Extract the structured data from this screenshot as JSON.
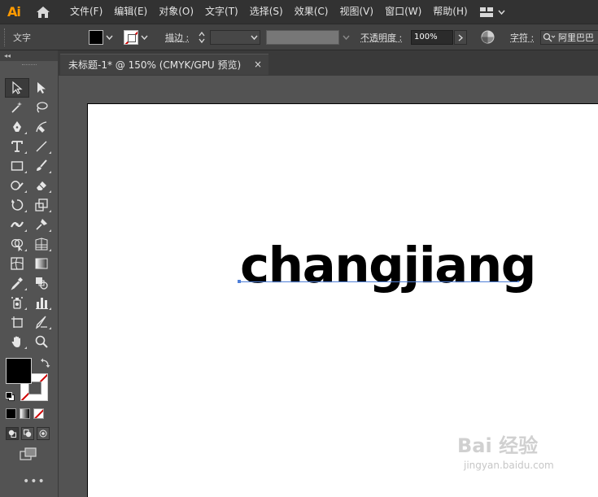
{
  "app": {
    "logo": "Ai"
  },
  "menubar": {
    "items": [
      "文件(F)",
      "编辑(E)",
      "对象(O)",
      "文字(T)",
      "选择(S)",
      "效果(C)",
      "视图(V)",
      "窗口(W)",
      "帮助(H)"
    ]
  },
  "controlbar": {
    "selection_label": "文字",
    "stroke_label": "描边 :",
    "opacity_label": "不透明度 :",
    "opacity_value": "100%",
    "character_label": "字符 :",
    "font_value": "阿里巴巴"
  },
  "document": {
    "tab_title": "未标题-1* @ 150% (CMYK/GPU 预览)",
    "close_glyph": "×",
    "artboard_text": "changjiang"
  },
  "tools": {
    "more": "•••"
  },
  "watermark": {
    "logo": "Bai 经验",
    "url": "jingyan.baidu.com"
  },
  "colors": {
    "menubar_bg": "#323232",
    "controlbar_bg": "#424242",
    "panel_bg": "#535353",
    "ai_logo": "#ff9a00",
    "selection_baseline": "#4f7fd8",
    "none_slash": "#d00000"
  }
}
